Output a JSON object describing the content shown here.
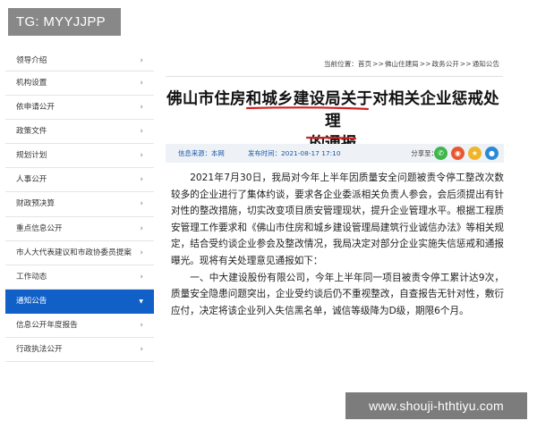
{
  "watermark_top": "TG: MYYJJPP",
  "watermark_bottom": "www.shouji-hthtiyu.com",
  "sidebar": {
    "items": [
      {
        "label": "领导介绍"
      },
      {
        "label": "机构设置"
      },
      {
        "label": "依申请公开"
      },
      {
        "label": "政策文件"
      },
      {
        "label": "规划计划"
      },
      {
        "label": "人事公开"
      },
      {
        "label": "财政预决算"
      },
      {
        "label": "重点信息公开"
      },
      {
        "label": "市人大代表建议和市政协委员提案"
      },
      {
        "label": "工作动态"
      },
      {
        "label": "通知公告",
        "active": true
      },
      {
        "label": "信息公开年度报告"
      },
      {
        "label": "行政执法公开"
      }
    ]
  },
  "breadcrumb": {
    "prefix": "当前位置：",
    "items": [
      "首页",
      "佛山住建局",
      "政务公开",
      "通知公告"
    ],
    "separator": ">>"
  },
  "article": {
    "title_line1": "佛山市住房和城乡建设局关于对相关企业惩戒处理",
    "title_line2": "的通报",
    "source": "信息来源：本网",
    "date": "发布时间：2021-08-17 17:10",
    "share_label": "分享至：",
    "share_icons": [
      {
        "name": "wechat-icon",
        "glyph": "✆",
        "color": "#3fb64a"
      },
      {
        "name": "weibo-icon",
        "glyph": "◉",
        "color": "#e9572e"
      },
      {
        "name": "qzone-icon",
        "glyph": "★",
        "color": "#f0b429"
      },
      {
        "name": "tencent-weibo-icon",
        "glyph": "●",
        "color": "#2a8ad8"
      }
    ],
    "paragraphs": [
      "2021年7月30日，我局对今年上半年因质量安全问题被责令停工整改次数较多的企业进行了集体约谈，要求各企业委派相关负责人参会，会后须提出有针对性的整改措施，切实改变项目质安管理现状，提升企业管理水平。根据工程质安管理工作要求和《佛山市住房和城乡建设管理局建筑行业诚信办法》等相关规定，结合受约谈企业参会及整改情况，我局决定对部分企业实施失信惩戒和通报曝光。现将有关处理意见通报如下：",
      "一、中大建设股份有限公司，今年上半年同一项目被责令停工累计达9次，质量安全隐患问题突出，企业受约谈后仍不重视整改，自查报告无针对性，敷衍应付，决定将该企业列入失信黑名单，诚信等级降为D级，期限6个月。"
    ]
  },
  "colors": {
    "active_nav": "#1060c8",
    "underline": "#d42020",
    "meta_bar": "#eef2f6",
    "meta_text": "#1a58a8"
  }
}
